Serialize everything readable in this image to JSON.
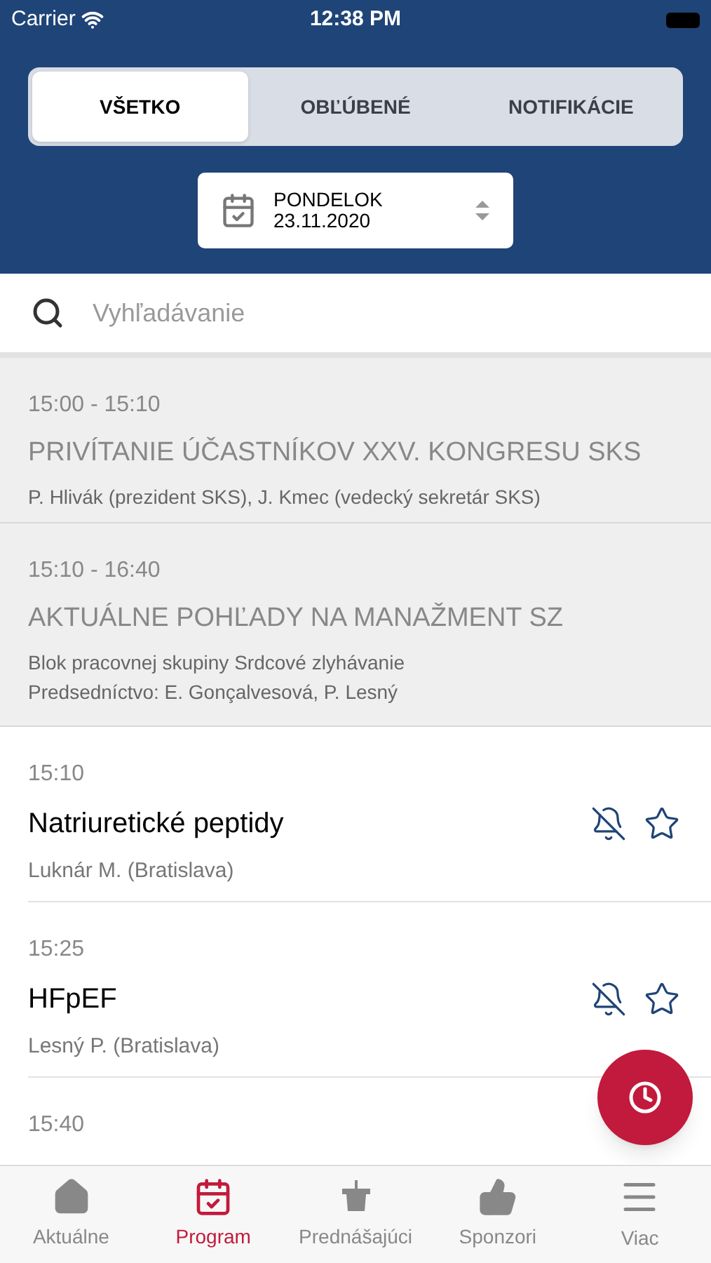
{
  "status_bar": {
    "carrier": "Carrier",
    "time": "12:38 PM"
  },
  "tabs": [
    {
      "label": "VŠETKO",
      "selected": true
    },
    {
      "label": "OBĽÚBENÉ",
      "selected": false
    },
    {
      "label": "NOTIFIKÁCIE",
      "selected": false
    }
  ],
  "date_picker": {
    "day": "PONDELOK",
    "date": "23.11.2020"
  },
  "search": {
    "placeholder": "Vyhľadávanie"
  },
  "sessions": [
    {
      "time": "15:00 - 15:10",
      "title": "PRIVÍTANIE ÚČASTNÍKOV XXV. KONGRESU SKS",
      "lines": [
        "P. Hlivák (prezident SKS), J. Kmec (vedecký sekretár SKS)"
      ]
    },
    {
      "time": "15:10 - 16:40",
      "title": "AKTUÁLNE POHĽADY NA MANAŽMENT SZ",
      "lines": [
        "Blok pracovnej skupiny Srdcové zlyhávanie",
        "Predsedníctvo: E. Gonçalvesová, P. Lesný"
      ]
    }
  ],
  "talks": [
    {
      "time": "15:10",
      "title": "Natriuretické peptidy",
      "speaker": "Luknár M. (Bratislava)",
      "notify": false,
      "favorite": false
    },
    {
      "time": "15:25",
      "title": "HFpEF",
      "speaker": "Lesný P. (Bratislava)",
      "notify": false,
      "favorite": false
    },
    {
      "time": "15:40"
    }
  ],
  "bottom_nav": [
    {
      "label": "Aktuálne",
      "kind": "home",
      "selected": false
    },
    {
      "label": "Program",
      "kind": "calendar",
      "selected": true
    },
    {
      "label": "Prednášajúci",
      "kind": "podium",
      "selected": false
    },
    {
      "label": "Sponzori",
      "kind": "thumb",
      "selected": false
    },
    {
      "label": "Viac",
      "kind": "menu",
      "selected": false
    }
  ]
}
